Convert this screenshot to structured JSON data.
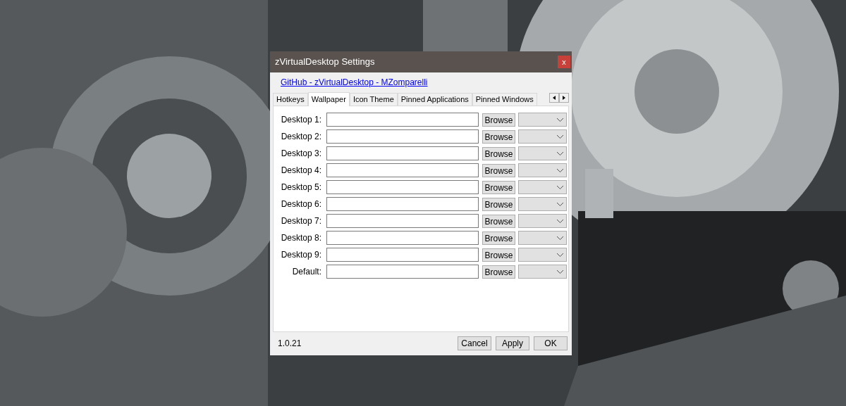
{
  "window": {
    "title": "zVirtualDesktop Settings",
    "close": "x"
  },
  "link": "GitHub - zVirtualDesktop - MZomparelli",
  "tabs": [
    {
      "label": "Hotkeys",
      "selected": false
    },
    {
      "label": "Wallpaper",
      "selected": true
    },
    {
      "label": "Icon Theme",
      "selected": false
    },
    {
      "label": "Pinned Applications",
      "selected": false
    },
    {
      "label": "Pinned Windows",
      "selected": false
    }
  ],
  "rows": [
    {
      "label": "Desktop 1:",
      "button": "Browse"
    },
    {
      "label": "Desktop 2:",
      "button": "Browse"
    },
    {
      "label": "Desktop 3:",
      "button": "Browse"
    },
    {
      "label": "Desktop 4:",
      "button": "Browse"
    },
    {
      "label": "Desktop 5:",
      "button": "Browse"
    },
    {
      "label": "Desktop 6:",
      "button": "Browse"
    },
    {
      "label": "Desktop 7:",
      "button": "Browse"
    },
    {
      "label": "Desktop 8:",
      "button": "Browse"
    },
    {
      "label": "Desktop 9:",
      "button": "Browse"
    },
    {
      "label": "Default:",
      "button": "Browse"
    }
  ],
  "version": "1.0.21",
  "buttons": [
    "Cancel",
    "Apply",
    "OK"
  ]
}
